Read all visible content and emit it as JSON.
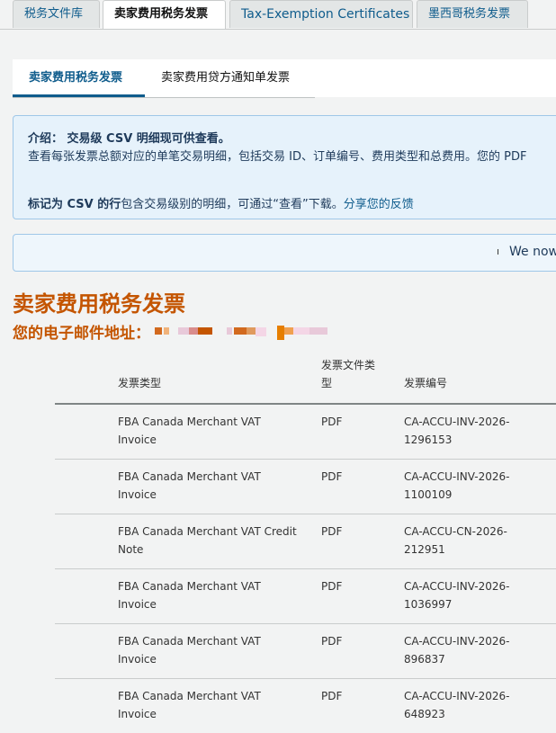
{
  "top_tabs": [
    {
      "label": "税务文件库",
      "active": false
    },
    {
      "label": "卖家费用税务发票",
      "active": true
    },
    {
      "label": "Tax-Exemption Certificates",
      "active": false
    },
    {
      "label": "墨西哥税务发票",
      "active": false
    }
  ],
  "sub_tabs": [
    {
      "label": "卖家费用税务发票",
      "active": true
    },
    {
      "label": "卖家费用贷方通知单发票",
      "active": false
    }
  ],
  "info": {
    "title": "介绍： 交易级 CSV 明细现可供查看。",
    "description": "查看每张发票总额对应的单笔交易明细，包括交易 ID、订单编号、费用类型和总费用。您的 PDF",
    "csv_bold": "标记为 CSV 的行",
    "csv_rest": "包含交易级别的明细，可通过“查看”下载。",
    "feedback_link": "分享您的反馈"
  },
  "notice": {
    "icon": "info-icon",
    "text": "We now"
  },
  "page_title": "卖家费用税务发票",
  "email_label": "您的电子邮件地址：",
  "table": {
    "headers": {
      "type": "发票类型",
      "format_line1": "发票文件类",
      "format_line2": "型",
      "number": "发票编号"
    },
    "rows": [
      {
        "type": "FBA Canada Merchant VAT Invoice",
        "format": "PDF",
        "number": "CA-ACCU-INV-2026-1296153"
      },
      {
        "type": "FBA Canada Merchant VAT Invoice",
        "format": "PDF",
        "number": "CA-ACCU-INV-2026-1100109"
      },
      {
        "type": "FBA Canada Merchant VAT Credit Note",
        "format": "PDF",
        "number": "CA-ACCU-CN-2026-212951"
      },
      {
        "type": "FBA Canada Merchant VAT Invoice",
        "format": "PDF",
        "number": "CA-ACCU-INV-2026-1036997"
      },
      {
        "type": "FBA Canada Merchant VAT Invoice",
        "format": "PDF",
        "number": "CA-ACCU-INV-2026-896837"
      },
      {
        "type": "FBA Canada Merchant VAT Invoice",
        "format": "PDF",
        "number": "CA-ACCU-INV-2026-648923"
      }
    ]
  },
  "colors": {
    "accent_orange": "#c45500",
    "link_blue": "#0f5c8c",
    "info_bg": "#e6f2fb"
  }
}
